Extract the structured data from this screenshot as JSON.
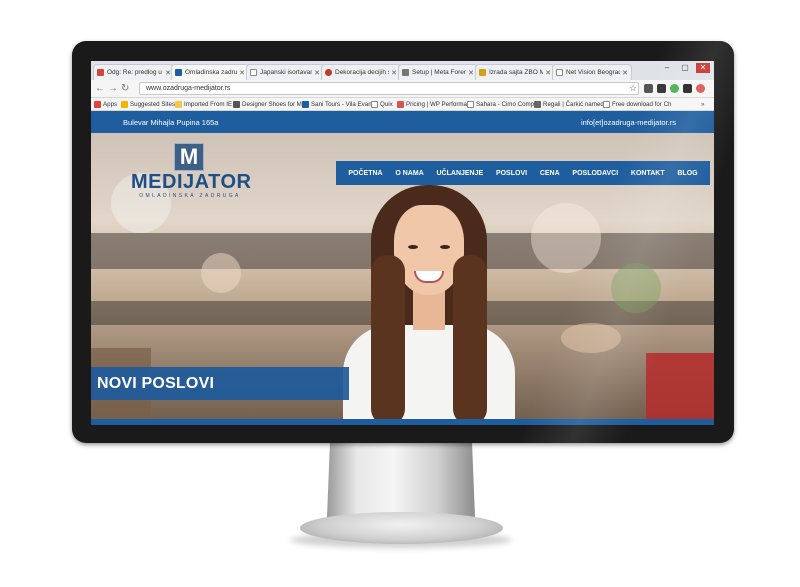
{
  "browser": {
    "tabs": [
      {
        "label": "Odg: Re: predlog u",
        "icon": "gmail-icon",
        "color": "#d44638"
      },
      {
        "label": "Omladinska zadrug",
        "icon": "site-icon",
        "color": "#1e5d9e"
      },
      {
        "label": "Japanski isortavanj",
        "icon": "page-icon",
        "color": "#888888"
      },
      {
        "label": "Dekoracija decijih s",
        "icon": "flower-icon",
        "color": "#c0392b"
      },
      {
        "label": "Setup | Meta Forem",
        "icon": "link-icon",
        "color": "#555555"
      },
      {
        "label": "Izrada sajta ZBO Mi",
        "icon": "page-icon",
        "color": "#d4a017"
      },
      {
        "label": "Net Vision Beograd",
        "icon": "page-icon",
        "color": "#888888"
      }
    ],
    "url": "www.ozadruga-medijator.rs",
    "bookmarks": [
      {
        "label": "Apps",
        "icon": "apps-icon",
        "color": "#e94235"
      },
      {
        "label": "Suggested Sites",
        "icon": "bing-icon",
        "color": "#f4b400"
      },
      {
        "label": "Imported From IE",
        "icon": "folder-icon",
        "color": "#f2c94c"
      },
      {
        "label": "Designer Shoes for M",
        "icon": "shoe-icon",
        "color": "#555555"
      },
      {
        "label": "Sani Tours - Vila Evan",
        "icon": "flag-icon",
        "color": "#1e5d9e"
      },
      {
        "label": "Quix",
        "icon": "page-icon",
        "color": "#888888"
      },
      {
        "label": "Pricing | WP Performa",
        "icon": "wp-icon",
        "color": "#d9534f"
      },
      {
        "label": "Sahara - Cimo Compa",
        "icon": "page-icon",
        "color": "#888888"
      },
      {
        "label": "Regali | Čarkić named",
        "icon": "bank-icon",
        "color": "#666666"
      },
      {
        "label": "Free download for Ch",
        "icon": "page-icon",
        "color": "#888888"
      }
    ],
    "overflow": "»"
  },
  "site": {
    "address": "Bulevar Mihajla Pupina 165a",
    "email": "info[et]ozadruga-medijator.rs",
    "logo": {
      "mark": "M",
      "name": "MEDIJATOR",
      "subtitle": "OMLADINSKA ZADRUGA"
    },
    "nav": [
      "POČETNA",
      "O NAMA",
      "UČLANJENJE",
      "POSLOVI",
      "CENA",
      "POSLODAVCI",
      "KONTAKT",
      "BLOG"
    ],
    "banner": "NOVI POSLOVI"
  },
  "colors": {
    "brand_blue": "#1e5d9e",
    "logo_blue": "#1e4f86"
  }
}
